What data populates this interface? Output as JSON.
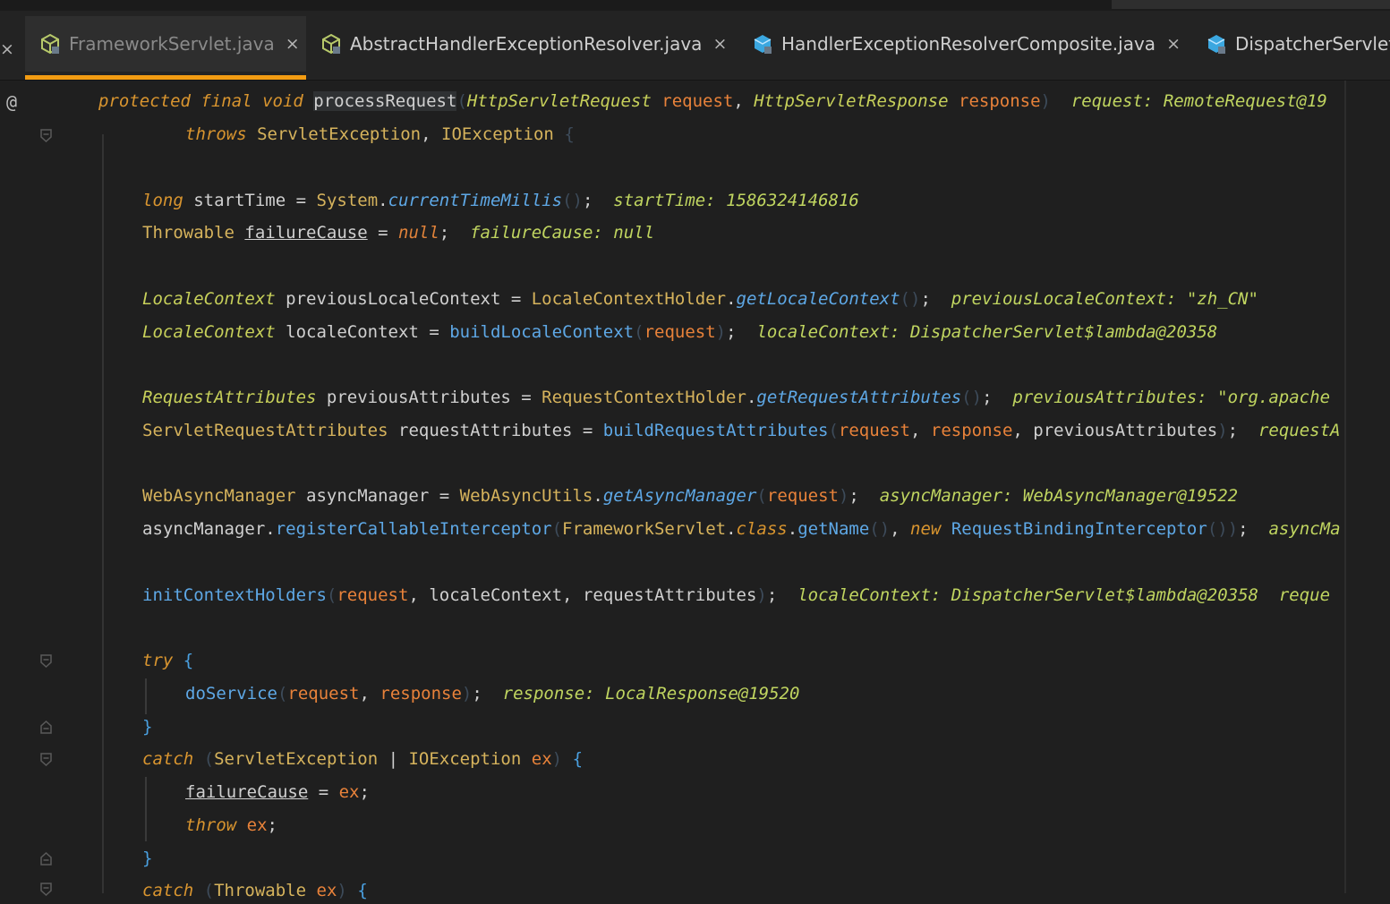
{
  "tabs": [
    {
      "label": "FrameworkServlet.java",
      "active": true,
      "icon": "java-class-icon"
    },
    {
      "label": "AbstractHandlerExceptionResolver.java",
      "active": false,
      "icon": "java-class-icon"
    },
    {
      "label": "HandlerExceptionResolverComposite.java",
      "active": false,
      "icon": "java-interface-icon"
    },
    {
      "label": "DispatcherServlet",
      "active": false,
      "icon": "java-interface-icon"
    }
  ],
  "tab_close_glyph": "×",
  "gutter": {
    "annotation_marker": "@"
  },
  "colors": {
    "background": "#1f1f1f",
    "keyword": "#d9952f",
    "type": "#d6b35c",
    "method": "#5ea8e6",
    "parameter": "#e8823a",
    "inline_hint": "#c0d560",
    "active_tab_underline": "#f39c12"
  },
  "code": {
    "l01": [
      {
        "t": "protected",
        "c": "kw"
      },
      {
        "t": " "
      },
      {
        "t": "final",
        "c": "kw"
      },
      {
        "t": " "
      },
      {
        "t": "void",
        "c": "kw"
      },
      {
        "t": " "
      },
      {
        "t": "processRequest",
        "c": "va hl"
      },
      {
        "t": "(",
        "c": "br"
      },
      {
        "t": "HttpServletRequest",
        "c": "ti"
      },
      {
        "t": " "
      },
      {
        "t": "request",
        "c": "pa"
      },
      {
        "t": ", ",
        "c": "pu"
      },
      {
        "t": "HttpServletResponse",
        "c": "ti"
      },
      {
        "t": " "
      },
      {
        "t": "response",
        "c": "pa"
      },
      {
        "t": ")",
        "c": "br"
      },
      {
        "t": "  request: RemoteRequest@19",
        "c": "hint"
      }
    ],
    "l02": [
      {
        "t": "throws",
        "c": "kw"
      },
      {
        "t": " "
      },
      {
        "t": "ServletException",
        "c": "ty"
      },
      {
        "t": ", ",
        "c": "pu"
      },
      {
        "t": "IOException",
        "c": "ty"
      },
      {
        "t": " "
      },
      {
        "t": "{",
        "c": "br"
      }
    ],
    "l03": [
      {
        "t": "long",
        "c": "kw"
      },
      {
        "t": " "
      },
      {
        "t": "startTime",
        "c": "va"
      },
      {
        "t": " = ",
        "c": "pu"
      },
      {
        "t": "System",
        "c": "ty"
      },
      {
        "t": ".",
        "c": "pu"
      },
      {
        "t": "currentTimeMillis",
        "c": "mi"
      },
      {
        "t": "()",
        "c": "br"
      },
      {
        "t": ";",
        "c": "pu"
      },
      {
        "t": "  startTime: 1586324146816",
        "c": "hint"
      }
    ],
    "l04": [
      {
        "t": "Throwable",
        "c": "ty"
      },
      {
        "t": " "
      },
      {
        "t": "failureCause",
        "c": "va ul"
      },
      {
        "t": " = ",
        "c": "pu"
      },
      {
        "t": "null",
        "c": "nul"
      },
      {
        "t": ";",
        "c": "pu"
      },
      {
        "t": "  failureCause: null",
        "c": "hint"
      }
    ],
    "l05": [
      {
        "t": "LocaleContext",
        "c": "ti"
      },
      {
        "t": " "
      },
      {
        "t": "previousLocaleContext",
        "c": "va"
      },
      {
        "t": " = ",
        "c": "pu"
      },
      {
        "t": "LocaleContextHolder",
        "c": "ty"
      },
      {
        "t": ".",
        "c": "pu"
      },
      {
        "t": "getLocaleContext",
        "c": "mi"
      },
      {
        "t": "()",
        "c": "br"
      },
      {
        "t": ";",
        "c": "pu"
      },
      {
        "t": "  previousLocaleContext: \"zh_CN\"",
        "c": "hint"
      }
    ],
    "l06": [
      {
        "t": "LocaleContext",
        "c": "ti"
      },
      {
        "t": " "
      },
      {
        "t": "localeContext",
        "c": "va"
      },
      {
        "t": " = ",
        "c": "pu"
      },
      {
        "t": "buildLocaleContext",
        "c": "me"
      },
      {
        "t": "(",
        "c": "br"
      },
      {
        "t": "request",
        "c": "pa"
      },
      {
        "t": ")",
        "c": "br"
      },
      {
        "t": ";",
        "c": "pu"
      },
      {
        "t": "  localeContext: DispatcherServlet$lambda@20358",
        "c": "hint"
      }
    ],
    "l07": [
      {
        "t": "RequestAttributes",
        "c": "ti"
      },
      {
        "t": " "
      },
      {
        "t": "previousAttributes",
        "c": "va"
      },
      {
        "t": " = ",
        "c": "pu"
      },
      {
        "t": "RequestContextHolder",
        "c": "ty"
      },
      {
        "t": ".",
        "c": "pu"
      },
      {
        "t": "getRequestAttributes",
        "c": "mi"
      },
      {
        "t": "()",
        "c": "br"
      },
      {
        "t": ";",
        "c": "pu"
      },
      {
        "t": "  previousAttributes: \"org.apache",
        "c": "hint"
      }
    ],
    "l08": [
      {
        "t": "ServletRequestAttributes",
        "c": "ty"
      },
      {
        "t": " "
      },
      {
        "t": "requestAttributes",
        "c": "va"
      },
      {
        "t": " = ",
        "c": "pu"
      },
      {
        "t": "buildRequestAttributes",
        "c": "me"
      },
      {
        "t": "(",
        "c": "br"
      },
      {
        "t": "request",
        "c": "pa"
      },
      {
        "t": ", ",
        "c": "pu"
      },
      {
        "t": "response",
        "c": "pa"
      },
      {
        "t": ", ",
        "c": "pu"
      },
      {
        "t": "previousAttributes",
        "c": "va"
      },
      {
        "t": ")",
        "c": "br"
      },
      {
        "t": ";",
        "c": "pu"
      },
      {
        "t": "  requestA",
        "c": "hint"
      }
    ],
    "l09": [
      {
        "t": "WebAsyncManager",
        "c": "ty"
      },
      {
        "t": " "
      },
      {
        "t": "asyncManager",
        "c": "va"
      },
      {
        "t": " = ",
        "c": "pu"
      },
      {
        "t": "WebAsyncUtils",
        "c": "ty"
      },
      {
        "t": ".",
        "c": "pu"
      },
      {
        "t": "getAsyncManager",
        "c": "mi"
      },
      {
        "t": "(",
        "c": "br"
      },
      {
        "t": "request",
        "c": "pa"
      },
      {
        "t": ")",
        "c": "br"
      },
      {
        "t": ";",
        "c": "pu"
      },
      {
        "t": "  asyncManager: WebAsyncManager@19522",
        "c": "hint"
      }
    ],
    "l10": [
      {
        "t": "asyncManager",
        "c": "va"
      },
      {
        "t": ".",
        "c": "pu"
      },
      {
        "t": "registerCallableInterceptor",
        "c": "me"
      },
      {
        "t": "(",
        "c": "br"
      },
      {
        "t": "FrameworkServlet",
        "c": "ty"
      },
      {
        "t": ".",
        "c": "pu"
      },
      {
        "t": "class",
        "c": "kw"
      },
      {
        "t": ".",
        "c": "pu"
      },
      {
        "t": "getName",
        "c": "me"
      },
      {
        "t": "()",
        "c": "br"
      },
      {
        "t": ", ",
        "c": "pu"
      },
      {
        "t": "new",
        "c": "kw"
      },
      {
        "t": " "
      },
      {
        "t": "RequestBindingInterceptor",
        "c": "me"
      },
      {
        "t": "())",
        "c": "br"
      },
      {
        "t": ";",
        "c": "pu"
      },
      {
        "t": "  asyncMa",
        "c": "hint"
      }
    ],
    "l11": [
      {
        "t": "initContextHolders",
        "c": "me"
      },
      {
        "t": "(",
        "c": "br"
      },
      {
        "t": "request",
        "c": "pa"
      },
      {
        "t": ", ",
        "c": "pu"
      },
      {
        "t": "localeContext",
        "c": "va"
      },
      {
        "t": ", ",
        "c": "pu"
      },
      {
        "t": "requestAttributes",
        "c": "va"
      },
      {
        "t": ")",
        "c": "br"
      },
      {
        "t": ";",
        "c": "pu"
      },
      {
        "t": "  localeContext: DispatcherServlet$lambda@20358  reque",
        "c": "hint"
      }
    ],
    "l12": [
      {
        "t": "try",
        "c": "kw"
      },
      {
        "t": " "
      },
      {
        "t": "{",
        "c": "bl"
      }
    ],
    "l13": [
      {
        "t": "doService",
        "c": "me"
      },
      {
        "t": "(",
        "c": "br"
      },
      {
        "t": "request",
        "c": "pa"
      },
      {
        "t": ", ",
        "c": "pu"
      },
      {
        "t": "response",
        "c": "pa"
      },
      {
        "t": ")",
        "c": "br"
      },
      {
        "t": ";",
        "c": "pu"
      },
      {
        "t": "  response: LocalResponse@19520",
        "c": "hint"
      }
    ],
    "l14": [
      {
        "t": "}",
        "c": "bl"
      }
    ],
    "l15": [
      {
        "t": "catch",
        "c": "kw"
      },
      {
        "t": " "
      },
      {
        "t": "(",
        "c": "br"
      },
      {
        "t": "ServletException",
        "c": "ty"
      },
      {
        "t": " | ",
        "c": "pu"
      },
      {
        "t": "IOException",
        "c": "ty"
      },
      {
        "t": " "
      },
      {
        "t": "ex",
        "c": "pa"
      },
      {
        "t": ")",
        "c": "br"
      },
      {
        "t": " "
      },
      {
        "t": "{",
        "c": "bl"
      }
    ],
    "l16": [
      {
        "t": "failureCause",
        "c": "va ul"
      },
      {
        "t": " = ",
        "c": "pu"
      },
      {
        "t": "ex",
        "c": "pa"
      },
      {
        "t": ";",
        "c": "pu"
      }
    ],
    "l17": [
      {
        "t": "throw",
        "c": "kw"
      },
      {
        "t": " "
      },
      {
        "t": "ex",
        "c": "pa"
      },
      {
        "t": ";",
        "c": "pu"
      }
    ],
    "l18": [
      {
        "t": "}",
        "c": "bl"
      }
    ],
    "l19": [
      {
        "t": "catch",
        "c": "kw"
      },
      {
        "t": " "
      },
      {
        "t": "(",
        "c": "br"
      },
      {
        "t": "Throwable",
        "c": "ty"
      },
      {
        "t": " "
      },
      {
        "t": "ex",
        "c": "pa"
      },
      {
        "t": ")",
        "c": "br"
      },
      {
        "t": " "
      },
      {
        "t": "{",
        "c": "bl"
      }
    ]
  }
}
